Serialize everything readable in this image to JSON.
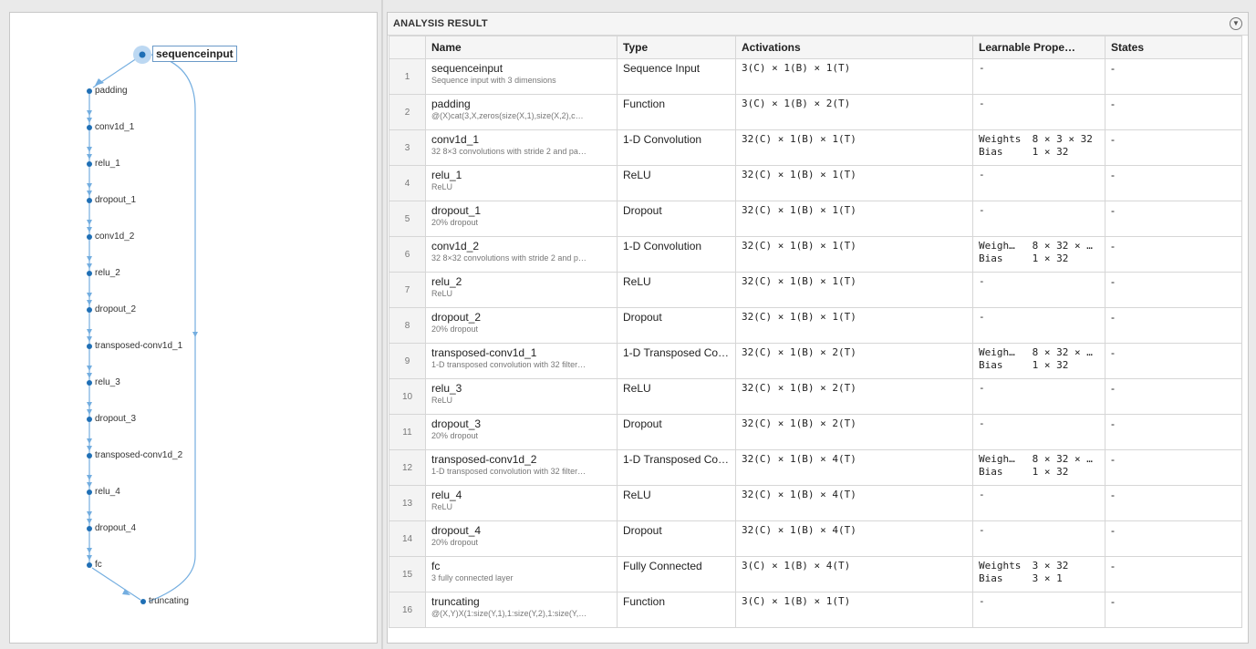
{
  "graph": {
    "selected_node": "sequenceinput",
    "nodes": [
      "padding",
      "conv1d_1",
      "relu_1",
      "dropout_1",
      "conv1d_2",
      "relu_2",
      "dropout_2",
      "transposed-conv1d_1",
      "relu_3",
      "dropout_3",
      "transposed-conv1d_2",
      "relu_4",
      "dropout_4",
      "fc",
      "truncating"
    ],
    "colors": {
      "node": "#1f6fb5",
      "edge": "#74aee0",
      "selected_halo": "#bcd8f2"
    }
  },
  "result": {
    "title": "ANALYSIS RESULT",
    "collapse_icon": "chevron-down-icon",
    "columns": [
      "",
      "Name",
      "Type",
      "Activations",
      "Learnable Prope…",
      "States"
    ],
    "rows": [
      {
        "idx": "1",
        "name": "sequenceinput",
        "desc": "Sequence input with 3 dimensions",
        "type": "Sequence Input",
        "act": "3(C) × 1(B) × 1(T)",
        "learn": [],
        "states": "-"
      },
      {
        "idx": "2",
        "name": "padding",
        "desc": "@(X)cat(3,X,zeros(size(X,1),size(X,2),c…",
        "type": "Function",
        "act": "3(C) × 1(B) × 2(T)",
        "learn": [],
        "states": "-"
      },
      {
        "idx": "3",
        "name": "conv1d_1",
        "desc": "32 8×3 convolutions with stride 2 and pa…",
        "type": "1-D Convolution",
        "act": "32(C) × 1(B) × 1(T)",
        "learn": [
          {
            "k": "Weights",
            "v": "8 × 3 × 32"
          },
          {
            "k": "Bias",
            "v": "1 × 32"
          }
        ],
        "states": "-"
      },
      {
        "idx": "4",
        "name": "relu_1",
        "desc": "ReLU",
        "type": "ReLU",
        "act": "32(C) × 1(B) × 1(T)",
        "learn": [],
        "states": "-"
      },
      {
        "idx": "5",
        "name": "dropout_1",
        "desc": "20% dropout",
        "type": "Dropout",
        "act": "32(C) × 1(B) × 1(T)",
        "learn": [],
        "states": "-"
      },
      {
        "idx": "6",
        "name": "conv1d_2",
        "desc": "32 8×32 convolutions with stride 2 and p…",
        "type": "1-D Convolution",
        "act": "32(C) × 1(B) × 1(T)",
        "learn": [
          {
            "k": "Weigh…",
            "v": "8 × 32 × …"
          },
          {
            "k": "Bias",
            "v": "1 × 32"
          }
        ],
        "states": "-"
      },
      {
        "idx": "7",
        "name": "relu_2",
        "desc": "ReLU",
        "type": "ReLU",
        "act": "32(C) × 1(B) × 1(T)",
        "learn": [],
        "states": "-"
      },
      {
        "idx": "8",
        "name": "dropout_2",
        "desc": "20% dropout",
        "type": "Dropout",
        "act": "32(C) × 1(B) × 1(T)",
        "learn": [],
        "states": "-"
      },
      {
        "idx": "9",
        "name": "transposed-conv1d_1",
        "desc": "1-D transposed convolution with 32 filter…",
        "type": "1-D Transposed Co…",
        "act": "32(C) × 1(B) × 2(T)",
        "learn": [
          {
            "k": "Weigh…",
            "v": "8 × 32 × …"
          },
          {
            "k": "Bias",
            "v": "1 × 32"
          }
        ],
        "states": "-"
      },
      {
        "idx": "10",
        "name": "relu_3",
        "desc": "ReLU",
        "type": "ReLU",
        "act": "32(C) × 1(B) × 2(T)",
        "learn": [],
        "states": "-"
      },
      {
        "idx": "11",
        "name": "dropout_3",
        "desc": "20% dropout",
        "type": "Dropout",
        "act": "32(C) × 1(B) × 2(T)",
        "learn": [],
        "states": "-"
      },
      {
        "idx": "12",
        "name": "transposed-conv1d_2",
        "desc": "1-D transposed convolution with 32 filter…",
        "type": "1-D Transposed Co…",
        "act": "32(C) × 1(B) × 4(T)",
        "learn": [
          {
            "k": "Weigh…",
            "v": "8 × 32 × …"
          },
          {
            "k": "Bias",
            "v": "1 × 32"
          }
        ],
        "states": "-"
      },
      {
        "idx": "13",
        "name": "relu_4",
        "desc": "ReLU",
        "type": "ReLU",
        "act": "32(C) × 1(B) × 4(T)",
        "learn": [],
        "states": "-"
      },
      {
        "idx": "14",
        "name": "dropout_4",
        "desc": "20% dropout",
        "type": "Dropout",
        "act": "32(C) × 1(B) × 4(T)",
        "learn": [],
        "states": "-"
      },
      {
        "idx": "15",
        "name": "fc",
        "desc": "3 fully connected layer",
        "type": "Fully Connected",
        "act": "3(C) × 1(B) × 4(T)",
        "learn": [
          {
            "k": "Weights",
            "v": "3 × 32"
          },
          {
            "k": "Bias",
            "v": "3 × 1"
          }
        ],
        "states": "-"
      },
      {
        "idx": "16",
        "name": "truncating",
        "desc": "@(X,Y)X(1:size(Y,1),1:size(Y,2),1:size(Y,…",
        "type": "Function",
        "act": "3(C) × 1(B) × 1(T)",
        "learn": [],
        "states": "-"
      }
    ]
  }
}
